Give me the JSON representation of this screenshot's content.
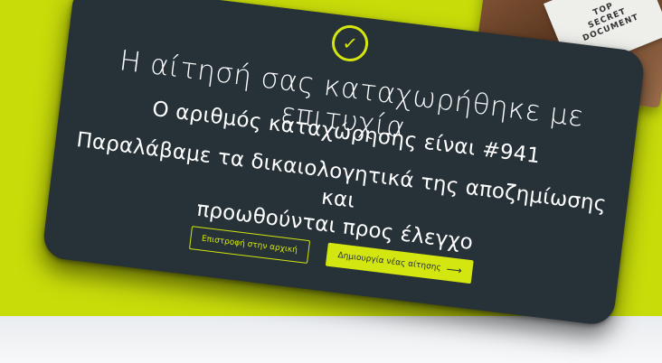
{
  "confirmation": {
    "title": "Η αίτησή σας καταχωρήθηκε με επιτυχία.",
    "registration_number_text": "Ο αριθμός καταχώρησης είναι #941",
    "message_line1": "Παραλάβαμε τα δικαιολογητικά της αποζημίωσης και",
    "message_line2": "προωθούνται προς έλεγχο",
    "back_home_label": "Επιστροφή στην αρχική",
    "new_application_label": "Δημιουργία νέας αίτησης",
    "check_glyph": "✓",
    "arrow_glyph": "⟶"
  },
  "background_paper": {
    "line1": "TOP",
    "line2": "SECRET",
    "line3": "DOCUMENT"
  },
  "colors": {
    "background": "#c8dc0a",
    "card": "#263138",
    "accent": "#d4e60f"
  },
  "icons": {
    "success": "check-circle-icon",
    "next": "arrow-right-icon"
  }
}
